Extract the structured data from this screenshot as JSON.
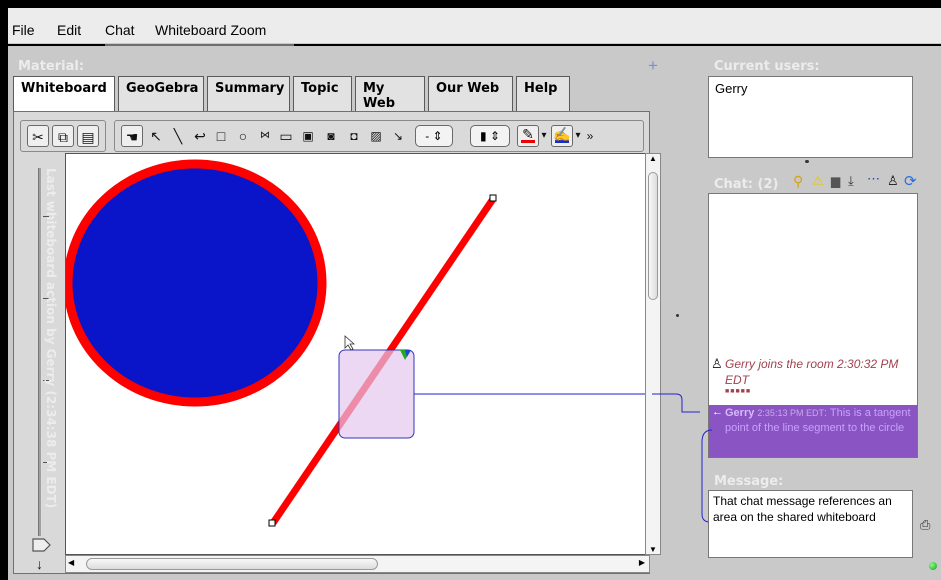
{
  "menu": {
    "file": "File",
    "edit": "Edit",
    "chat": "Chat",
    "whiteboard_zoom": "Whiteboard Zoom"
  },
  "material": {
    "title": "Material:",
    "add_symbol": "+",
    "tabs": [
      {
        "label": "Whiteboard"
      },
      {
        "label": "GeoGebra"
      },
      {
        "label": "Summary"
      },
      {
        "label": "Topic"
      },
      {
        "label": "My Web"
      },
      {
        "label": "Our Web"
      },
      {
        "label": "Help"
      }
    ],
    "toolbar": {
      "line_width_value": "-",
      "dropdown_arrow": "▾",
      "more_symbol": "»"
    },
    "side_label": "Last whiteboard action by Gerry (2:34:38 PM EDT)",
    "side_download": "↓"
  },
  "users": {
    "title": "Current users:",
    "list": [
      "Gerry"
    ]
  },
  "chat": {
    "title": "Chat: (2)",
    "messages": [
      {
        "text": "Gerry joins the room 2:30:32 PM EDT"
      },
      {
        "author": "Gerry",
        "time": "2:35:13 PM EDT",
        "body": "This is a tangent point of the line segment to the circle"
      }
    ],
    "placeholder_marks": "■■■■■"
  },
  "message": {
    "title": "Message:",
    "value": "That chat message references an area on the shared whiteboard"
  },
  "colors": {
    "circle_fill": "#0a14c8",
    "circle_stroke": "#ff0000",
    "line": "#ff0000",
    "note_fill": "#e6c8f0",
    "chat_highlight": "#8a55c2",
    "connector": "#2222cc"
  }
}
